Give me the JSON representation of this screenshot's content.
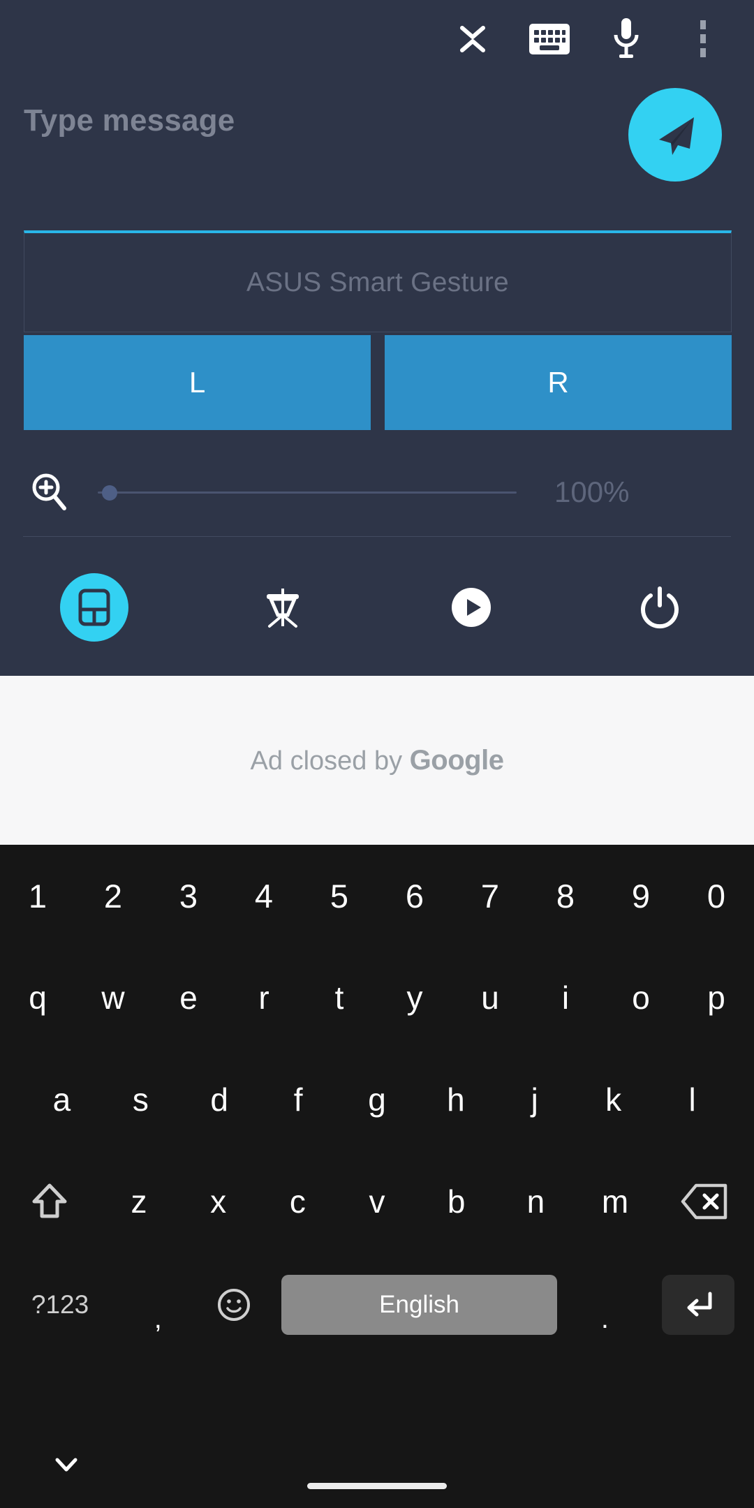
{
  "theme": {
    "panel_bg": "#2e3548",
    "accent_cyan": "#33d1f2",
    "button_blue": "#2e90c8",
    "keyboard_bg": "#161616",
    "ad_bg": "#f7f7f8",
    "placeholder_gray": "#7e8494"
  },
  "topbar": {
    "items": [
      {
        "icon": "collapse-icon",
        "name": "collapse-button"
      },
      {
        "icon": "keyboard-icon",
        "name": "keyboard-button"
      },
      {
        "icon": "microphone-icon",
        "name": "microphone-button"
      },
      {
        "icon": "overflow-menu-icon",
        "name": "overflow-menu-button"
      }
    ]
  },
  "message": {
    "placeholder": "Type message",
    "value": "",
    "send_icon": "send-icon"
  },
  "touchpad": {
    "label": "ASUS Smart Gesture"
  },
  "mouse_buttons": {
    "left_label": "L",
    "right_label": "R"
  },
  "zoom": {
    "icon": "zoom-in-icon",
    "value_label": "100%",
    "value": 100,
    "min": 100,
    "max": 400,
    "thumb_percent": 0
  },
  "modebar": {
    "items": [
      {
        "label": "Touchpad",
        "icon": "touchpad-icon",
        "active": true
      },
      {
        "label": "Presentation",
        "icon": "presentation-icon",
        "active": false
      },
      {
        "label": "Media",
        "icon": "play-icon",
        "active": false
      },
      {
        "label": "Power",
        "icon": "power-icon",
        "active": false
      }
    ]
  },
  "ad": {
    "text_prefix": "Ad closed by ",
    "brand": "Google"
  },
  "keyboard": {
    "numbers": [
      "1",
      "2",
      "3",
      "4",
      "5",
      "6",
      "7",
      "8",
      "9",
      "0"
    ],
    "row_top": [
      "q",
      "w",
      "e",
      "r",
      "t",
      "y",
      "u",
      "i",
      "o",
      "p"
    ],
    "row_home": [
      "a",
      "s",
      "d",
      "f",
      "g",
      "h",
      "j",
      "k",
      "l"
    ],
    "row_shift": [
      "z",
      "x",
      "c",
      "v",
      "b",
      "n",
      "m"
    ],
    "shift_icon": "shift-icon",
    "backspace_icon": "backspace-icon",
    "symbols_label": "?123",
    "comma_label": ",",
    "emoji_icon": "emoji-icon",
    "space_label": "English",
    "period_label": ".",
    "enter_icon": "enter-icon"
  },
  "navbar": {
    "hide_keyboard_icon": "chevron-down-icon",
    "home_indicator": "home-indicator"
  }
}
